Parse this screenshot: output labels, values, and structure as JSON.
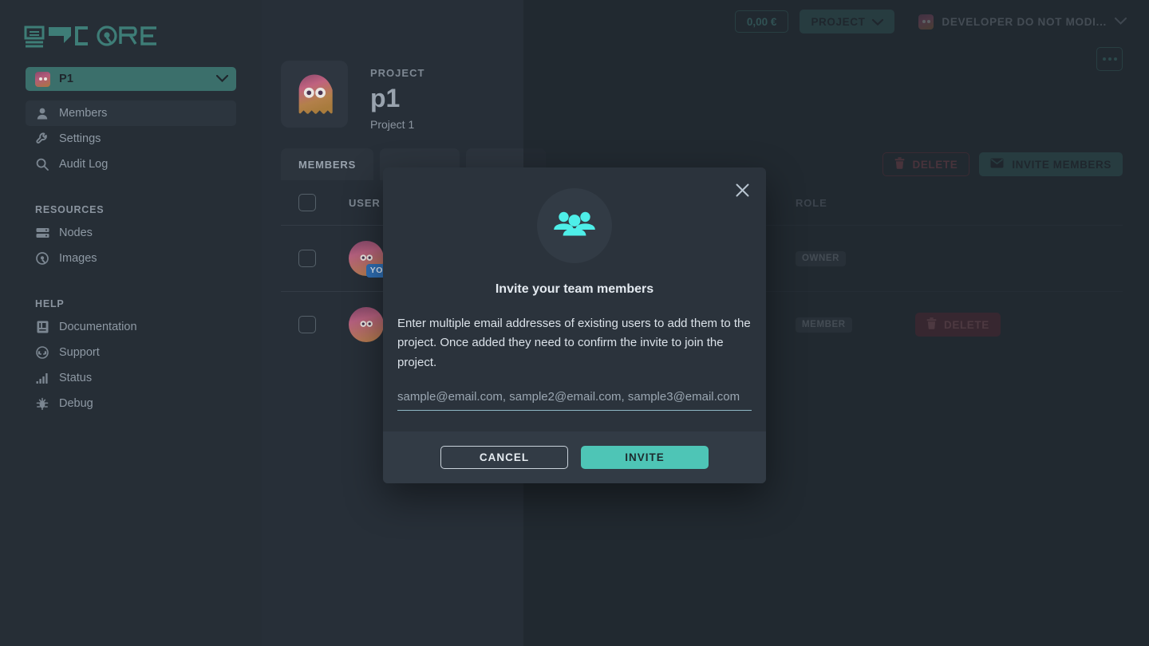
{
  "brand": {
    "name": "CORE",
    "accent": "#3b6f6b",
    "cyan": "#4eeee8",
    "danger": "#a8505d"
  },
  "sidebar": {
    "project_selector": {
      "label": "P1",
      "icon": "ghost-avatar-icon",
      "chevron": "chevron-down-icon"
    },
    "nav": [
      {
        "label": "Members",
        "icon": "user-icon",
        "active": true
      },
      {
        "label": "Settings",
        "icon": "wrench-icon",
        "active": false
      },
      {
        "label": "Audit Log",
        "icon": "search-icon",
        "active": false
      }
    ],
    "sections": [
      {
        "heading": "RESOURCES",
        "items": [
          {
            "label": "Nodes",
            "icon": "server-icon"
          },
          {
            "label": "Images",
            "icon": "disc-icon"
          }
        ]
      },
      {
        "heading": "HELP",
        "items": [
          {
            "label": "Documentation",
            "icon": "book-icon"
          },
          {
            "label": "Support",
            "icon": "headset-icon"
          },
          {
            "label": "Status",
            "icon": "bar-chart-icon"
          },
          {
            "label": "Debug",
            "icon": "bug-icon"
          }
        ]
      }
    ]
  },
  "topbar": {
    "credit": "0,00 €",
    "project_button": {
      "label": "PROJECT",
      "chevron": "chevron-down-icon"
    },
    "user": {
      "name": "DEVELOPER DO NOT MODI...",
      "avatar": "ghost-avatar-icon",
      "chevron": "chevron-down-icon"
    }
  },
  "project_header": {
    "kicker": "PROJECT",
    "title": "p1",
    "subtitle": "Project 1",
    "avatar": "ghost-avatar-icon",
    "kebab": "more-options-icon"
  },
  "tabs": [
    {
      "label": "MEMBERS",
      "active": true
    },
    {
      "label": "",
      "active": false
    },
    {
      "label": "",
      "active": false
    }
  ],
  "tab_actions": {
    "delete": {
      "label": "DELETE",
      "icon": "trash-icon"
    },
    "invite": {
      "label": "INVITE MEMBERS",
      "icon": "envelope-icon"
    }
  },
  "table": {
    "columns": {
      "user": "USER",
      "role": "ROLE"
    },
    "rows": [
      {
        "selected": false,
        "avatar": "ghost-avatar-icon",
        "you_badge": "YOU",
        "name": "",
        "email": "",
        "role": "OWNER",
        "action": null
      },
      {
        "selected": false,
        "avatar": "ghost-avatar-icon",
        "you_badge": null,
        "name": "",
        "email": "",
        "role": "MEMBER",
        "action": {
          "label": "DELETE",
          "icon": "trash-icon"
        }
      }
    ]
  },
  "modal": {
    "close_icon": "close-icon",
    "hero_icon": "users-icon",
    "title": "Invite your team members",
    "description": "Enter multiple email addresses of existing users to add them to the project. Once added they need to confirm the invite to join the project.",
    "input": {
      "value": "",
      "placeholder": "sample@email.com, sample2@email.com, sample3@email.com"
    },
    "cancel_label": "CANCEL",
    "confirm_label": "INVITE"
  }
}
